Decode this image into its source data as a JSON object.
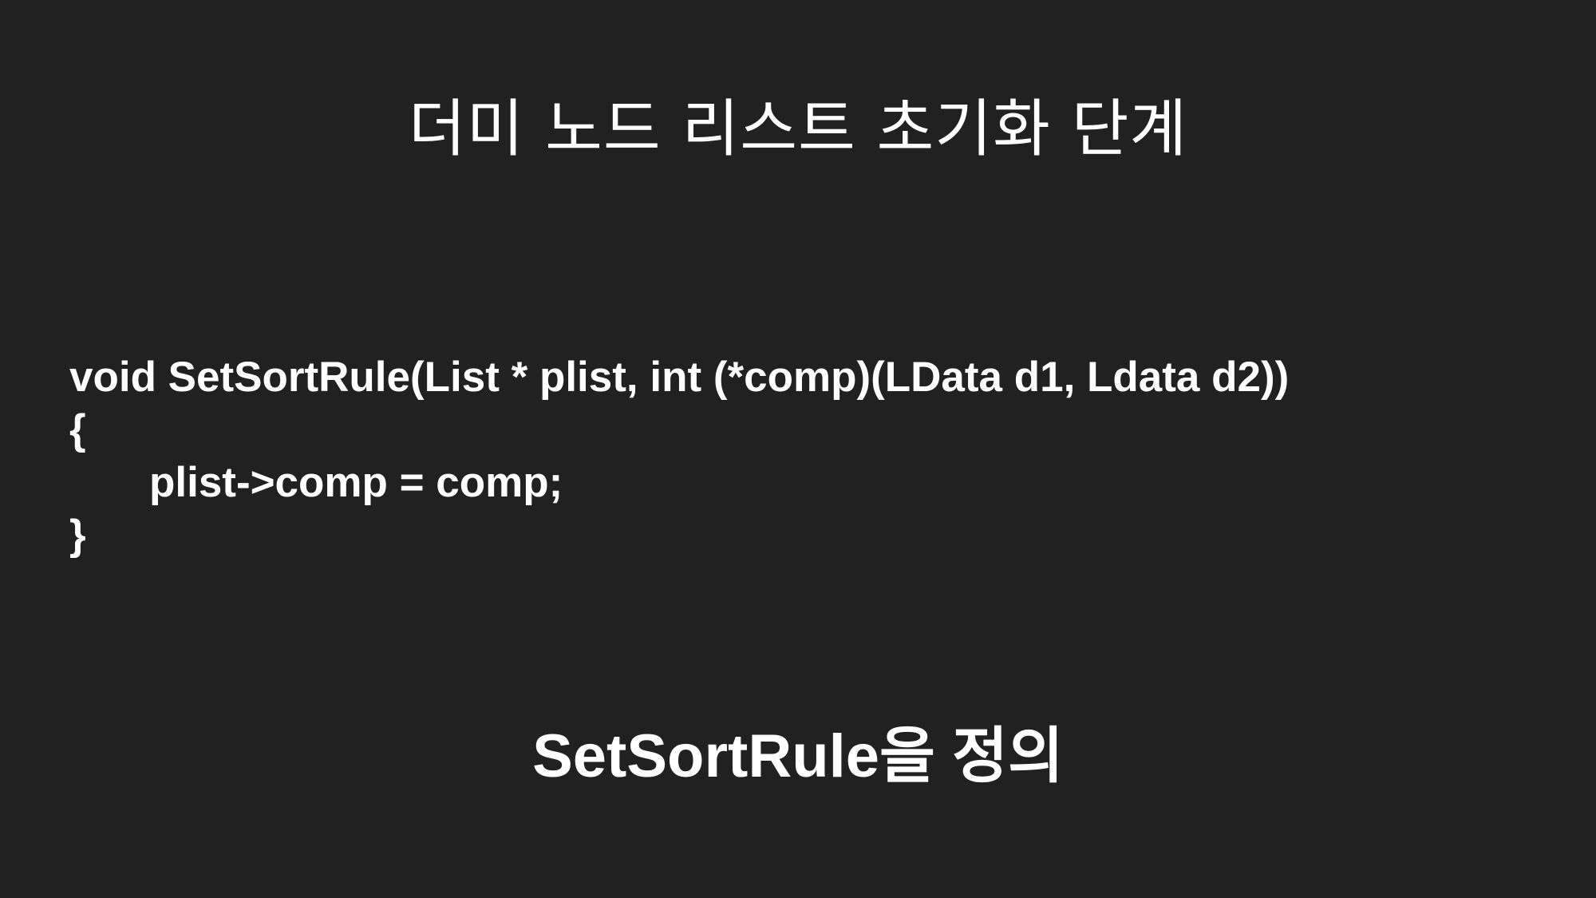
{
  "slide": {
    "title": "더미 노드 리스트 초기화 단계",
    "code_lines": [
      "void SetSortRule(List * plist, int (*comp)(LData d1, Ldata d2))",
      "{",
      "plist->comp = comp;",
      "}"
    ],
    "caption": "SetSortRule을 정의"
  },
  "colors": {
    "background": "#212121",
    "text": "#ffffff"
  }
}
